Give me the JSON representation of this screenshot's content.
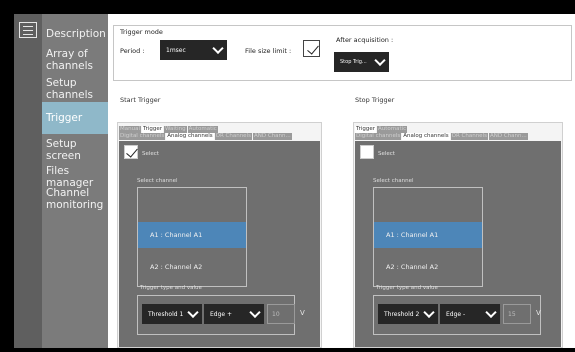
{
  "sidebar": {
    "items": [
      {
        "label": "Description"
      },
      {
        "label": "Array of channels"
      },
      {
        "label": "Setup channels"
      },
      {
        "label": "Trigger"
      },
      {
        "label": "Setup screen"
      },
      {
        "label": "Files manager"
      },
      {
        "label": "Channel monitoring"
      }
    ],
    "active_color": "#8fb8c9"
  },
  "trigger_mode": {
    "title": "Trigger mode",
    "period_label": "Period :",
    "period_value": "1msec",
    "file_size_label": "File size limit :",
    "file_size_checked": true,
    "after_acq_label": "After acquisition :",
    "after_acq_value": "Stop Trig..."
  },
  "start_trigger": {
    "title": "Start Trigger",
    "tabs_row1": [
      "Manual",
      "Trigger",
      "Waiting",
      "Automatic"
    ],
    "tabs_row1_selected": "Trigger",
    "tabs_row2": [
      "Digital channels",
      "Analog channels",
      "OR Channels",
      "AND Chann..."
    ],
    "tabs_row2_selected": "Analog channels",
    "select_label": "Select",
    "select_checked": true,
    "select_channel_label": "Select channel",
    "channels": [
      "A1 : Channel A1",
      "A2 : Channel A2"
    ],
    "selected_channel": "A1 : Channel A1",
    "trigger_type_label": "Trigger type and value",
    "threshold": "Threshold 1",
    "edge": "Edge +",
    "value": "10",
    "unit": "V"
  },
  "stop_trigger": {
    "title": "Stop Trigger",
    "tabs_row1": [
      "Trigger",
      "Automatic"
    ],
    "tabs_row1_selected": "Trigger",
    "tabs_row2": [
      "Digital channels",
      "Analog channels",
      "OR Channels",
      "AND Chann..."
    ],
    "tabs_row2_selected": "Analog channels",
    "select_label": "Select",
    "select_checked": false,
    "select_channel_label": "Select channel",
    "channels": [
      "A1 : Channel A1",
      "A2 : Channel A2"
    ],
    "selected_channel": "A1 : Channel A1",
    "trigger_type_label": "Trigger type and value",
    "threshold": "Threshold 2",
    "edge": "Edge -",
    "value": "15",
    "unit": "V"
  }
}
